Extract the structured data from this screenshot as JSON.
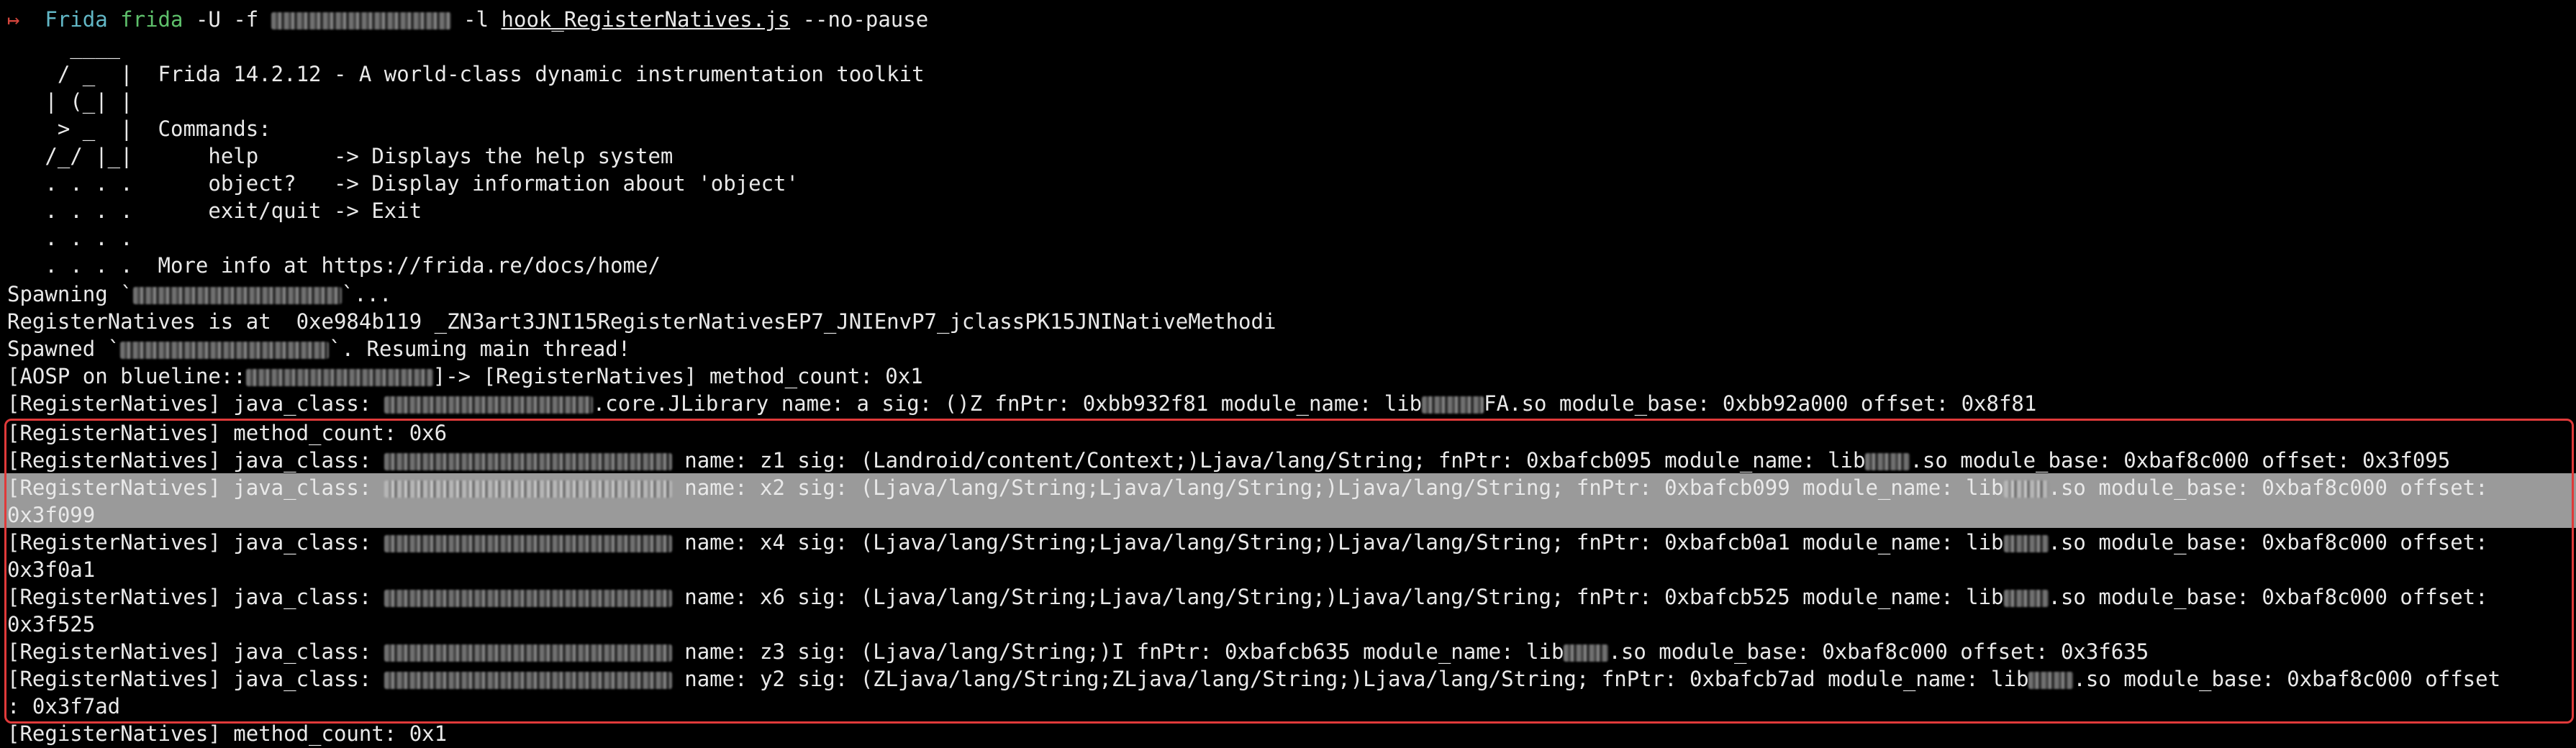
{
  "terminal": {
    "prompt_arrow": "↦",
    "command": {
      "prog": "Frida",
      "cmd": "frida",
      "args_before_blur": " -U -f ",
      "args_mid": " -l ",
      "script": "hook_RegisterNatives.js",
      "args_after": " --no-pause"
    },
    "banner": [
      {
        "art": "     ____",
        "text": ""
      },
      {
        "art": "    / _  |",
        "text": "  Frida 14.2.12 - A world-class dynamic instrumentation toolkit"
      },
      {
        "art": "   | (_| |",
        "text": ""
      },
      {
        "art": "    > _  |",
        "text": "  Commands:"
      },
      {
        "art": "   /_/ |_|",
        "text": "      help      -> Displays the help system"
      },
      {
        "art": "   . . . .",
        "text": "      object?   -> Display information about 'object'"
      },
      {
        "art": "   . . . .",
        "text": "      exit/quit -> Exit"
      },
      {
        "art": "   . . . .",
        "text": ""
      },
      {
        "art": "   . . . .",
        "text": "  More info at https://frida.re/docs/home/"
      }
    ],
    "output": {
      "spawning": "Spawning `",
      "spawning_end": "`...",
      "register_at": "RegisterNatives is at  0xe984b119 _ZN3art3JNI15RegisterNativesEP7_JNIEnvP7_jclassPK15JNINativeMethodi",
      "spawned": "Spawned `",
      "spawned_end": "`. Resuming main thread!",
      "aosp_start": "[AOSP on blueline::",
      "aosp_end": "]-> [RegisterNatives] method_count: 0x1",
      "first_a": "[RegisterNatives] java_class: ",
      "first_b": ".core.JLibrary name: a sig: ()Z fnPtr: 0xbb932f81 module_name: lib",
      "first_c": "FA.so module_base: 0xbb92a000 offset: 0x8f81",
      "count6": "[RegisterNatives] method_count: 0x6",
      "prefix": "[RegisterNatives] java_class: ",
      "rows": [
        {
          "a": " name: z1 sig: (Landroid/content/Context;)Ljava/lang/String; fnPtr: 0xbafcb095 module_name: lib",
          "b": ".so module_base: 0xbaf8c000 offset: 0x3f095",
          "wrap": ""
        },
        {
          "a": " name: x2 sig: (Ljava/lang/String;Ljava/lang/String;)Ljava/lang/String; fnPtr: 0xbafcb099 module_name: lib",
          "b": ".so module_base: 0xbaf8c000 offset:",
          "wrap": "0x3f099"
        },
        {
          "a": " name: x4 sig: (Ljava/lang/String;Ljava/lang/String;)Ljava/lang/String; fnPtr: 0xbafcb0a1 module_name: lib",
          "b": ".so module_base: 0xbaf8c000 offset:",
          "wrap": "0x3f0a1"
        },
        {
          "a": " name: x6 sig: (Ljava/lang/String;Ljava/lang/String;)Ljava/lang/String; fnPtr: 0xbafcb525 module_name: lib",
          "b": ".so module_base: 0xbaf8c000 offset:",
          "wrap": "0x3f525"
        },
        {
          "a": " name: z3 sig: (Ljava/lang/String;)I fnPtr: 0xbafcb635 module_name: lib",
          "b": ".so module_base: 0xbaf8c000 offset: 0x3f635",
          "wrap": ""
        },
        {
          "a": " name: y2 sig: (ZLjava/lang/String;ZLjava/lang/String;)Ljava/lang/String; fnPtr: 0xbafcb7ad module_name: lib",
          "b": ".so module_base: 0xbaf8c000 offset",
          "wrap": ": 0x3f7ad"
        }
      ],
      "last": "[RegisterNatives] method_count: 0x1"
    },
    "colors": {
      "background": "#000000",
      "text": "#e9e9e9",
      "highlight": "#9a9a9a",
      "box": "#e03a3a"
    }
  }
}
